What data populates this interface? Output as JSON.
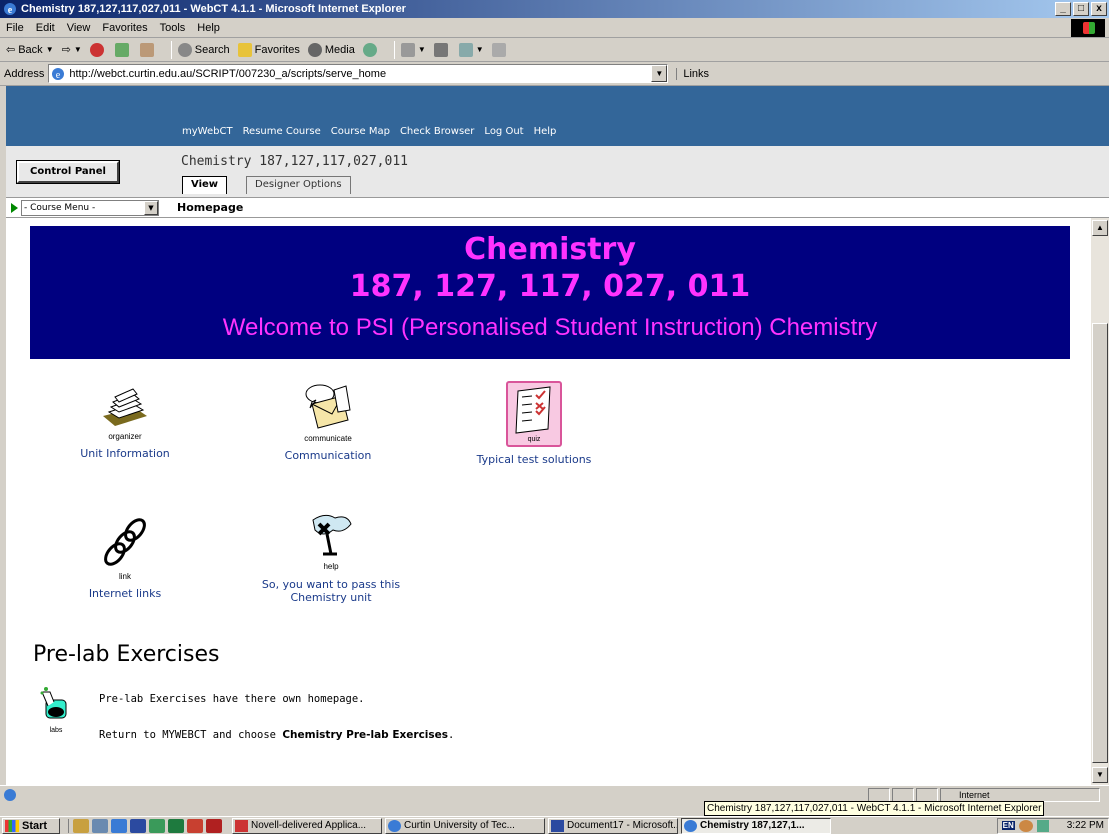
{
  "window": {
    "title": "Chemistry 187,127,117,027,011 - WebCT 4.1.1 - Microsoft Internet Explorer",
    "buttons": [
      "_",
      "□",
      "x"
    ]
  },
  "menubar": [
    "File",
    "Edit",
    "View",
    "Favorites",
    "Tools",
    "Help"
  ],
  "toolbar": {
    "back": "Back",
    "search": "Search",
    "favorites": "Favorites",
    "media": "Media"
  },
  "address": {
    "label": "Address",
    "url": "http://webct.curtin.edu.au/SCRIPT/007230_a/scripts/serve_home",
    "links": "Links"
  },
  "webct_nav": [
    "myWebCT",
    "Resume Course",
    "Course Map",
    "Check Browser",
    "Log Out",
    "Help"
  ],
  "header": {
    "control_panel": "Control Panel",
    "course_title": "Chemistry 187,127,117,027,011",
    "tab_view": "View",
    "tab_designer": "Designer Options"
  },
  "course_menu": {
    "select": "- Course Menu -",
    "breadcrumb": "Homepage"
  },
  "banner": {
    "line1": "Chemistry",
    "line2": "187, 127, 117, 027, 011",
    "line3": "Welcome to PSI (Personalised Student Instruction) Chemistry",
    "bg_color": "#000080",
    "text_color": "#ff33ff"
  },
  "tools": [
    {
      "icon": "organizer-icon",
      "caption": "organizer",
      "link": "Unit Information"
    },
    {
      "icon": "communicate-icon",
      "caption": "communicate",
      "link": "Communication"
    },
    {
      "icon": "quiz-icon",
      "caption": "quiz",
      "link": "Typical test solutions"
    },
    {
      "icon": "link-icon",
      "caption": "link",
      "link": "Internet links"
    },
    {
      "icon": "help-icon",
      "caption": "help",
      "link_line1": "So, you want to pass this",
      "link_line2": "Chemistry unit"
    }
  ],
  "prelab": {
    "heading": "Pre-lab Exercises",
    "icon_caption": "labs",
    "line1": "Pre-lab Exercises have there own homepage.",
    "line2_pre": "Return to MYWEBCT and choose ",
    "line2_bold": "Chemistry Pre-lab Exercises",
    "line2_post": "."
  },
  "status": {
    "zone": "Internet",
    "tooltip": "Chemistry 187,127,117,027,011 - WebCT 4.1.1 - Microsoft Internet Explorer"
  },
  "taskbar": {
    "start": "Start",
    "tasks": [
      "Novell-delivered Applica...",
      "Curtin University of Tec...",
      "Document17 - Microsoft...",
      "Chemistry 187,127,1..."
    ],
    "lang": "EN",
    "clock": "3:22 PM"
  }
}
